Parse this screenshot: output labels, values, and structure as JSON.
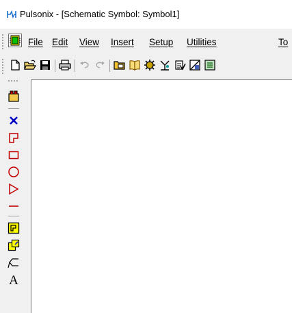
{
  "window": {
    "title": "Pulsonix - [Schematic Symbol: Symbol1]",
    "app_icon": "pulsonix-app-icon"
  },
  "menubar": {
    "app_icon": "schematic-symbol-icon",
    "items": [
      "File",
      "Edit",
      "View",
      "Insert",
      "Setup",
      "Utilities",
      "To"
    ]
  },
  "toolbar": {
    "buttons": [
      "new-icon",
      "open-icon",
      "save-icon",
      "print-icon",
      "undo-icon",
      "redo-icon",
      "design-manager-icon",
      "library-manager-icon",
      "component-icon",
      "design-rules-icon",
      "check-icon",
      "report-icon",
      "more-icon"
    ]
  },
  "left_toolbar": {
    "buttons": [
      "edit-tools-icon",
      "delete-icon",
      "add-pin-icon",
      "add-rectangle-icon",
      "add-circle-icon",
      "add-triangle-icon",
      "add-line-icon",
      "add-component-icon",
      "copy-component-icon",
      "add-label-icon",
      "add-text-icon"
    ]
  },
  "colors": {
    "accent_red": "#c00000",
    "accent_blue": "#0000c8",
    "highlight_yellow": "#ffff00"
  }
}
